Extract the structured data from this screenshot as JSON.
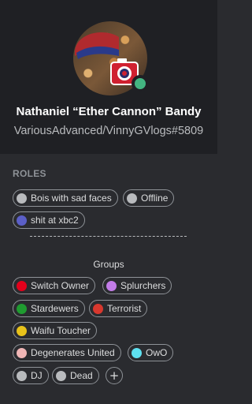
{
  "profile": {
    "display_name": "Nathaniel “Ether Cannon” Bandy",
    "tag": "VariousAdvanced/VinnyGVlogs#5809",
    "status": "online",
    "status_color": "#43b581"
  },
  "roles": {
    "title": "ROLES",
    "items": [
      {
        "label": "Bois with sad faces",
        "color": "#b9bbbe"
      },
      {
        "label": "Offline",
        "color": "#b9bbbe"
      },
      {
        "label": "shit at xbc2",
        "color": "#5b5fc7"
      }
    ],
    "separator": "-------------------------------------",
    "groups_label": "Groups",
    "groups": [
      {
        "label": "Switch Owner",
        "color": "#e3001b"
      },
      {
        "label": "Splurchers",
        "color": "#c27ce8"
      },
      {
        "label": "Stardewers",
        "color": "#1f9b30"
      },
      {
        "label": "Terrorist",
        "color": "#d8382e"
      },
      {
        "label": "Waifu Toucher",
        "color": "#e8c21a"
      },
      {
        "label": "Degenerates United",
        "color": "#f0b6b6"
      },
      {
        "label": "OwO",
        "color": "#5ee0f0"
      },
      {
        "label": "DJ",
        "color": "#b9bbbe"
      },
      {
        "label": "Dead",
        "color": "#b9bbbe"
      }
    ],
    "add_label": "+"
  }
}
